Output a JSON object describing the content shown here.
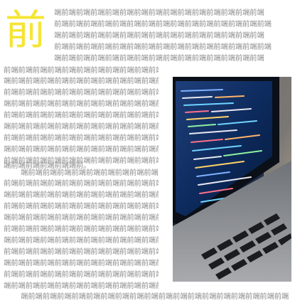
{
  "article": {
    "dropcap": "前",
    "lines": [
      "端前端前端前端前端前端前端前端前端前端前端前端前端前端前端",
      "前端前端前端前端前端前端前端前端前端前端前端前端前端前端前端",
      "端前端前端前端前端前端前端前端前端前端前端前端前端前端前端",
      "前端前端前端前端前端前端前端前端前端前端前端前端前端前端前端",
      "端前端前端前端前端前端前端前端前端前端前端前端前端前端前端",
      "前端前端前端前端前端前端前端前端前端前端前端前端",
      "端前端前端前端前端前端前端前端前端前端前端前端前端前",
      "前端前端前端前端前端前端前端前端前端前端前端前端",
      "端前端前端前端前端前端前端前端前端前端前端前端前端前",
      "前端前端前端前端前端前端前端前端前端前端前端前端",
      "端前端前端前端前端前端前端前端前端前端前端前端前端前",
      "前端前端前端前端前端前端前端前端前端前端前端前端",
      "端前端前端前端前端前端前端前端前端前端前端前端前端前",
      "前端前端前端前端前端前端前端前端前端前端前端前端",
      "端前端前端前端前端端前。",
      "端前端前端前端前端前端前端前端前端前端前端",
      "前端前端前端前端前端前端前端前端前端前端前端前端",
      "端前端前端前端前端前端前端前端前端前端前端前端前端前",
      "前端前端前端前端前端前端前端前端前端前端前端前端",
      "端前端前端前端前端前端前端前端前端前端前端前端前端前",
      "前端前端前端前端前端前端前端前端前端前端前端前端",
      "端前端前端前端前端前端前端前端前端前端前端前端前端前",
      "前端前端前端前端前端前端前端前端前端前端前端前端",
      "端前端前端前端前端前端前端前端前端前端前端前端前端前",
      "前端前端前端前端前端前端前端前端前端前端前端前端",
      "端前端前端前端前端前端前端前端前端前端前端前端前端前",
      "端前端前端前端前端前端前端前端前端前端前端前端前端前端前端前端前端前端前端"
    ]
  }
}
